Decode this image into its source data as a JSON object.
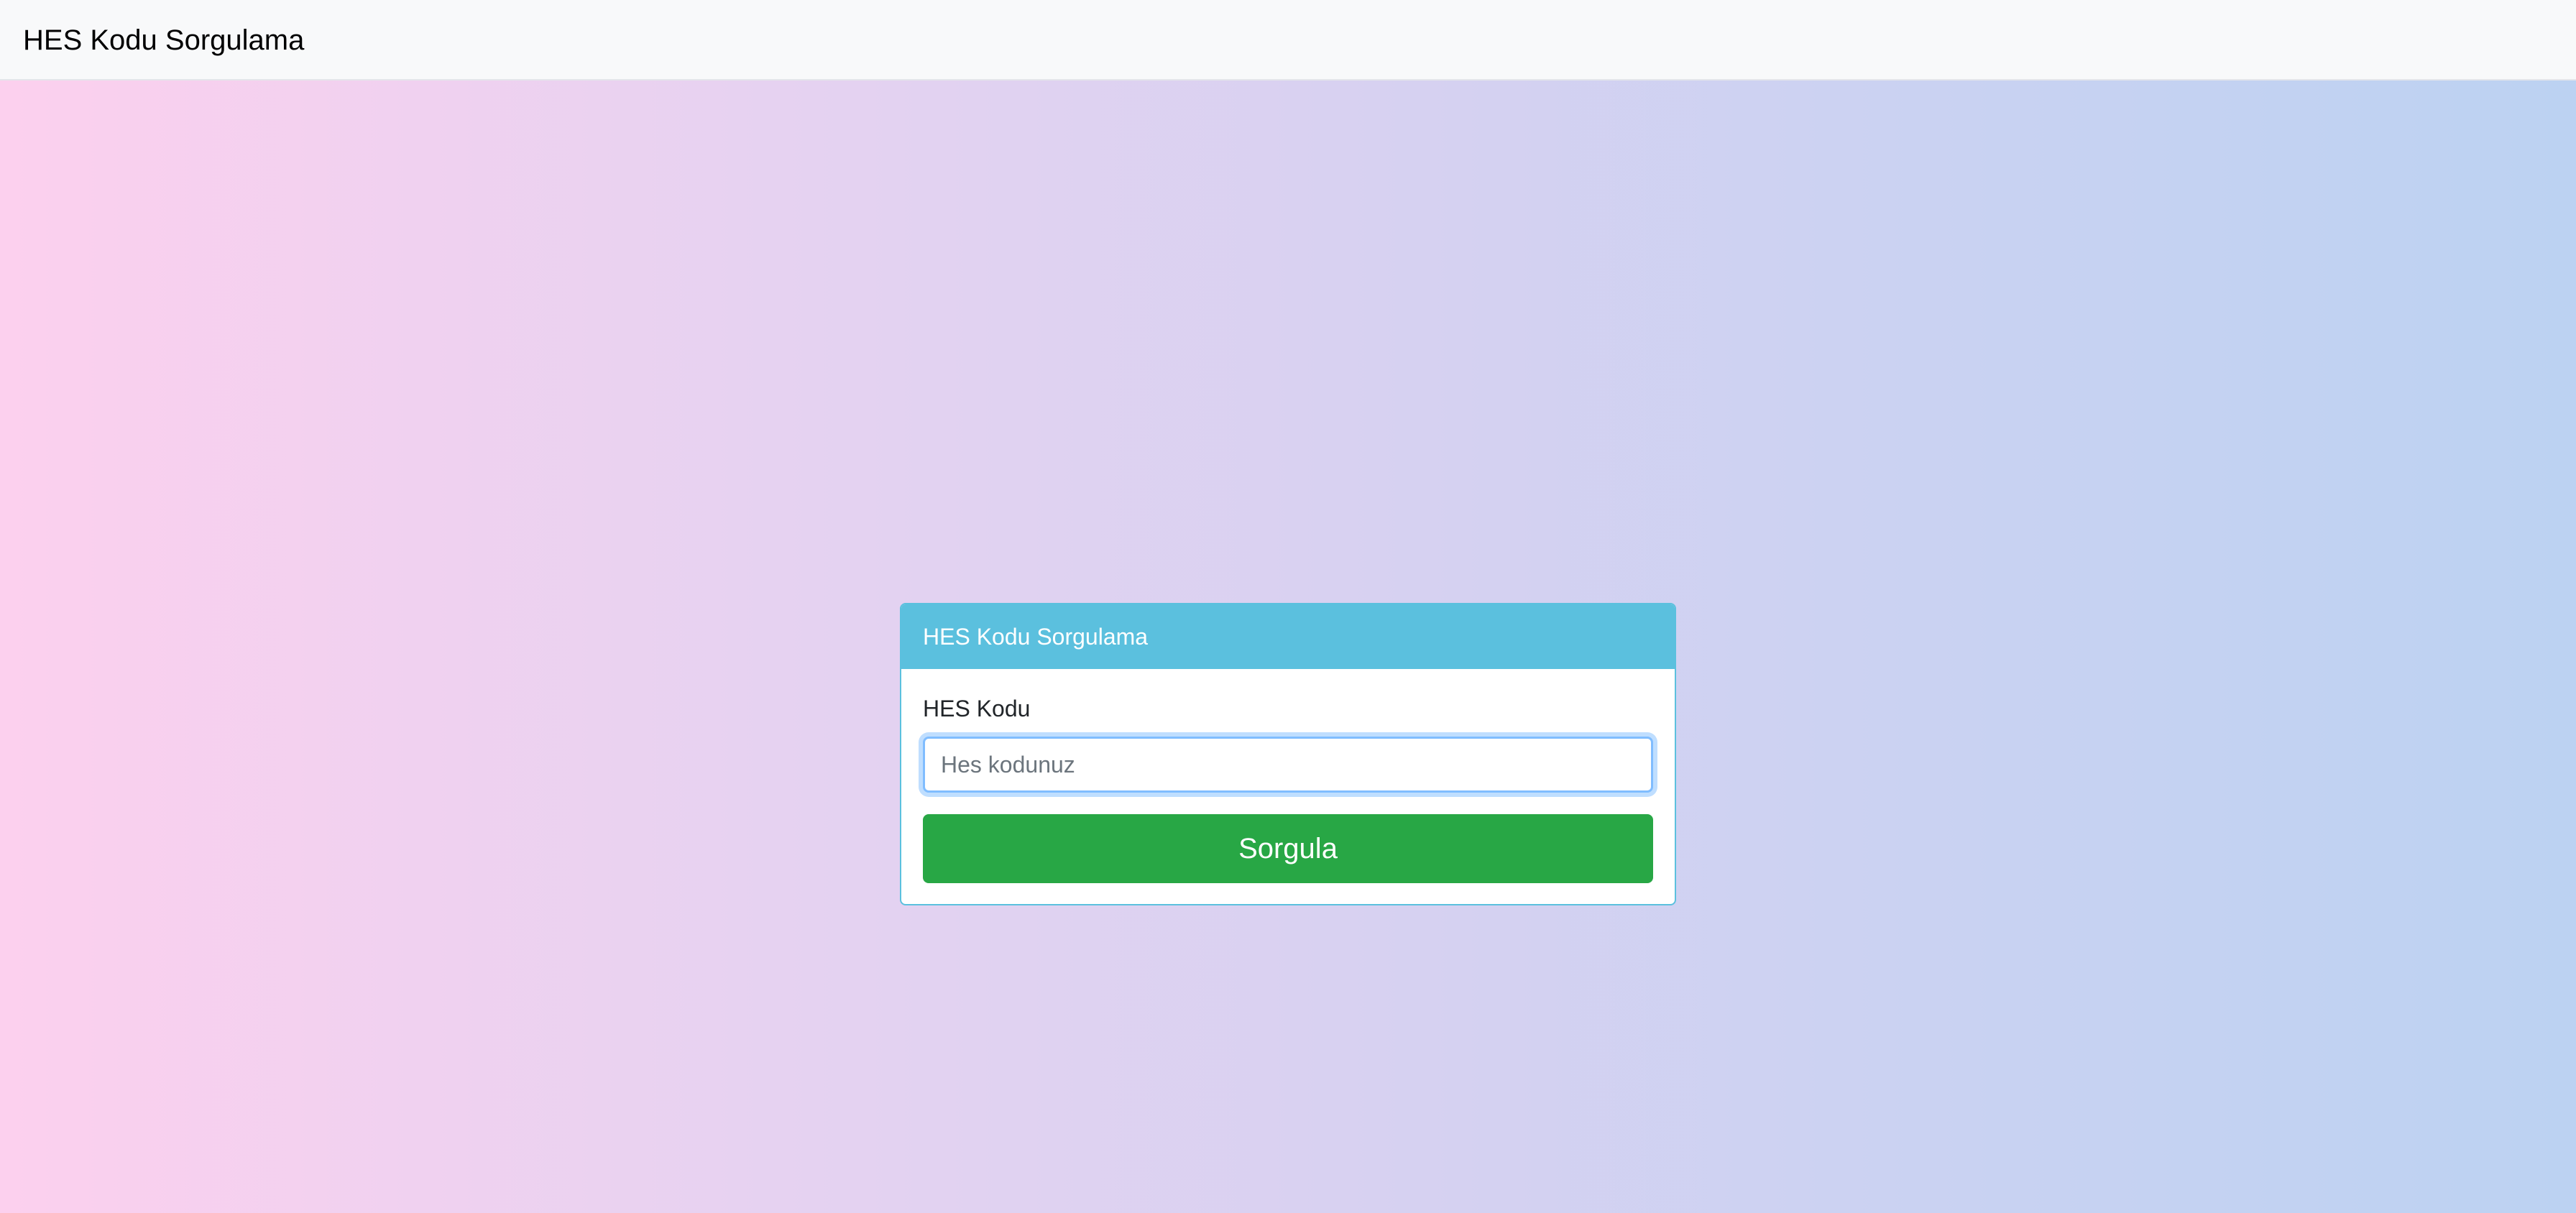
{
  "navbar": {
    "brand": "HES Kodu Sorgulama"
  },
  "card": {
    "header_title": "HES Kodu Sorgulama",
    "field_label": "HES Kodu",
    "input_placeholder": "Hes kodunuz",
    "input_value": "",
    "submit_label": "Sorgula"
  },
  "colors": {
    "card_header": "#5bc0de",
    "submit_button": "#28a745",
    "gradient_left": "#fcd0ee",
    "gradient_right": "#bcd2f2"
  }
}
